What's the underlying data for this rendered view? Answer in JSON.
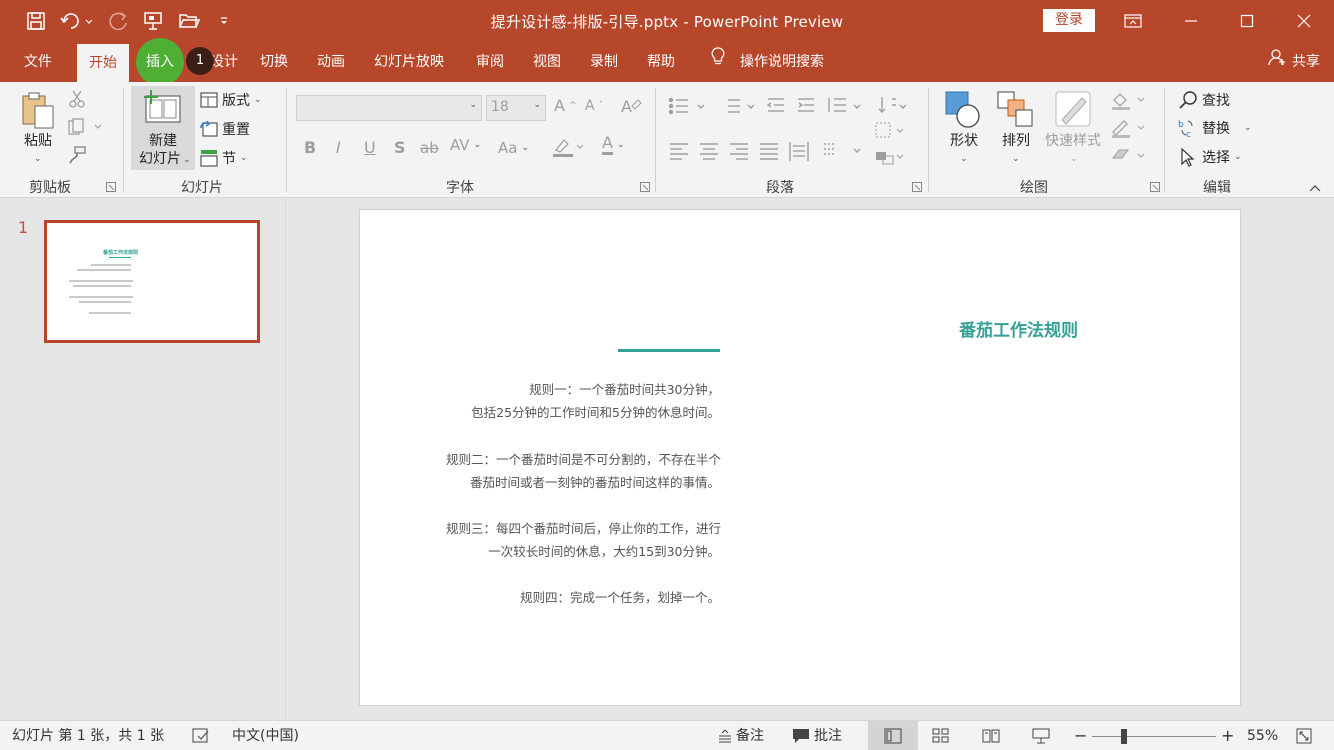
{
  "window": {
    "title": "提升设计感-排版-引导.pptx  -  PowerPoint Preview",
    "login_label": "登录"
  },
  "tabs": {
    "file": "文件",
    "home": "开始",
    "insert": "插入",
    "design": "设计",
    "transitions": "切换",
    "animations": "动画",
    "slideshow": "幻灯片放映",
    "review": "审阅",
    "view": "视图",
    "record": "录制",
    "help": "帮助",
    "tellme": "操作说明搜索",
    "share": "共享",
    "badge": "1"
  },
  "ribbon": {
    "clipboard": {
      "paste": "粘贴",
      "group_label": "剪贴板"
    },
    "slides": {
      "new_slide_line1": "新建",
      "new_slide_line2": "幻灯片",
      "layout": "版式",
      "reset": "重置",
      "section": "节",
      "group_label": "幻灯片"
    },
    "font": {
      "font_name": "",
      "font_size": "18",
      "bold": "B",
      "italic": "I",
      "underline": "U",
      "strike": "S",
      "strikethrough": "ab",
      "spacing": "AV",
      "case": "Aa",
      "color": "A",
      "group_label": "字体"
    },
    "paragraph": {
      "group_label": "段落"
    },
    "drawing": {
      "shapes": "形状",
      "arrange": "排列",
      "quick_styles": "快速样式",
      "group_label": "绘图"
    },
    "editing": {
      "find": "查找",
      "replace": "替换",
      "select": "选择",
      "group_label": "编辑"
    }
  },
  "thumbnails": [
    {
      "number": "1",
      "title": "番茄工作法规则"
    }
  ],
  "slide": {
    "title": "番茄工作法规则",
    "lines": [
      "规则一：一个番茄时间共30分钟，",
      "包括25分钟的工作时间和5分钟的休息时间。",
      "规则二：一个番茄时间是不可分割的，不存在半个",
      "番茄时间或者一刻钟的番茄时间这样的事情。",
      "规则三：每四个番茄时间后，停止你的工作，进行",
      "一次较长时间的休息，大约15到30分钟。",
      "规则四：完成一个任务，划掉一个。"
    ]
  },
  "status": {
    "slide_info": "幻灯片 第 1 张，共 1 张",
    "language": "中文(中国)",
    "notes": "备注",
    "comments": "批注",
    "zoom_minus": "−",
    "zoom_plus": "+",
    "zoom": "55%"
  },
  "colors": {
    "accent": "#b7472a",
    "slide_title": "#35a095",
    "insert_highlight": "#44b935"
  }
}
